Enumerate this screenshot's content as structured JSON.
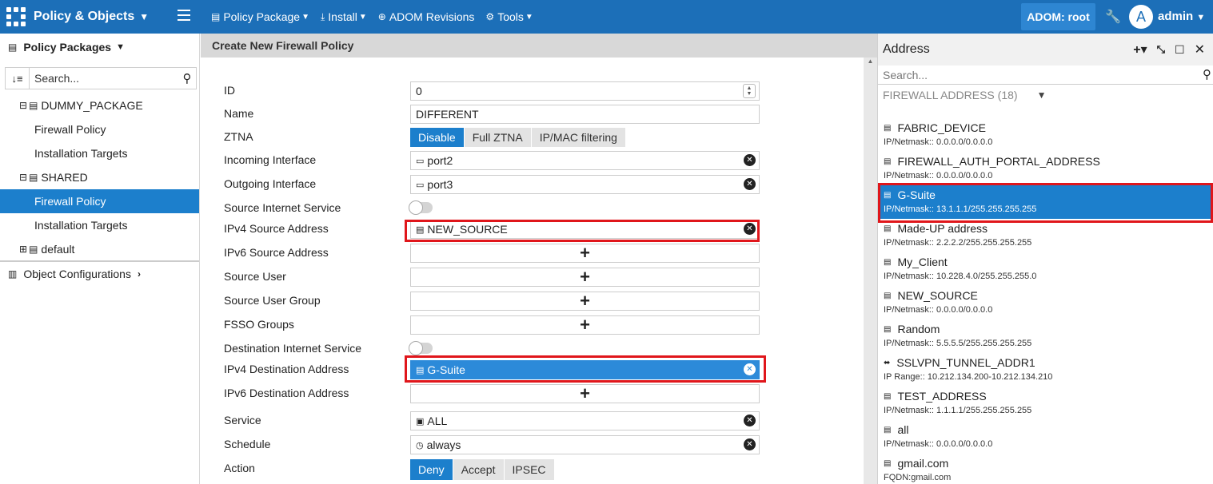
{
  "topbar": {
    "title": "Policy & Objects",
    "menu": [
      {
        "label": "Policy Package",
        "icon": "folder-icon"
      },
      {
        "label": "Install",
        "icon": "install-icon"
      },
      {
        "label": "ADOM Revisions",
        "icon": "globe-icon"
      },
      {
        "label": "Tools",
        "icon": "gear-icon"
      }
    ],
    "adom": "ADOM: root",
    "avatar_letter": "A",
    "user": "admin"
  },
  "sidebar": {
    "header": "Policy Packages",
    "search_placeholder": "Search...",
    "tree": [
      {
        "label": "DUMMY_PACKAGE",
        "toggle": "⊟"
      },
      {
        "label": "Firewall Policy"
      },
      {
        "label": "Installation Targets"
      },
      {
        "label": "SHARED",
        "toggle": "⊟"
      },
      {
        "label": "Firewall Policy"
      },
      {
        "label": "Installation Targets"
      },
      {
        "label": "default",
        "toggle": "⊞"
      }
    ],
    "object_configurations": "Object Configurations"
  },
  "form": {
    "title": "Create New Firewall Policy",
    "labels": {
      "id": "ID",
      "name": "Name",
      "ztna": "ZTNA",
      "incoming": "Incoming Interface",
      "outgoing": "Outgoing Interface",
      "src_inet": "Source Internet Service",
      "ipv4_src": "IPv4 Source Address",
      "ipv6_src": "IPv6 Source Address",
      "src_user": "Source User",
      "src_group": "Source User Group",
      "fsso": "FSSO Groups",
      "dst_inet": "Destination Internet Service",
      "ipv4_dst": "IPv4 Destination Address",
      "ipv6_dst": "IPv6 Destination Address",
      "service": "Service",
      "schedule": "Schedule",
      "action": "Action"
    },
    "values": {
      "id": "0",
      "name": "DIFFERENT",
      "incoming": "port2",
      "outgoing": "port3",
      "ipv4_src": "NEW_SOURCE",
      "ipv4_dst": "G-Suite",
      "service": "ALL",
      "schedule": "always"
    },
    "ztna_options": [
      "Disable",
      "Full ZTNA",
      "IP/MAC filtering"
    ],
    "action_options": [
      "Deny",
      "Accept",
      "IPSEC"
    ],
    "add_symbol": "+"
  },
  "address_panel": {
    "title": "Address",
    "search_placeholder": "Search...",
    "category": "FIREWALL ADDRESS (18)",
    "items": [
      {
        "name": "FABRIC_DEVICE",
        "detail": "IP/Netmask:: 0.0.0.0/0.0.0.0"
      },
      {
        "name": "FIREWALL_AUTH_PORTAL_ADDRESS",
        "detail": "IP/Netmask:: 0.0.0.0/0.0.0.0"
      },
      {
        "name": "G-Suite",
        "detail": "IP/Netmask:: 13.1.1.1/255.255.255.255"
      },
      {
        "name": "Made-UP address",
        "detail": "IP/Netmask:: 2.2.2.2/255.255.255.255"
      },
      {
        "name": "My_Client",
        "detail": "IP/Netmask:: 10.228.4.0/255.255.255.0"
      },
      {
        "name": "NEW_SOURCE",
        "detail": "IP/Netmask:: 0.0.0.0/0.0.0.0"
      },
      {
        "name": "Random",
        "detail": "IP/Netmask:: 5.5.5.5/255.255.255.255"
      },
      {
        "name": "SSLVPN_TUNNEL_ADDR1",
        "detail": "IP Range:: 10.212.134.200-10.212.134.210"
      },
      {
        "name": "TEST_ADDRESS",
        "detail": "IP/Netmask:: 1.1.1.1/255.255.255.255"
      },
      {
        "name": "all",
        "detail": "IP/Netmask:: 0.0.0.0/0.0.0.0"
      },
      {
        "name": "gmail.com",
        "detail": "FQDN:gmail.com"
      }
    ]
  },
  "colors": {
    "topbar": "#1c6fb8",
    "selected": "#1c7fcc",
    "highlight": "#e0161b"
  }
}
